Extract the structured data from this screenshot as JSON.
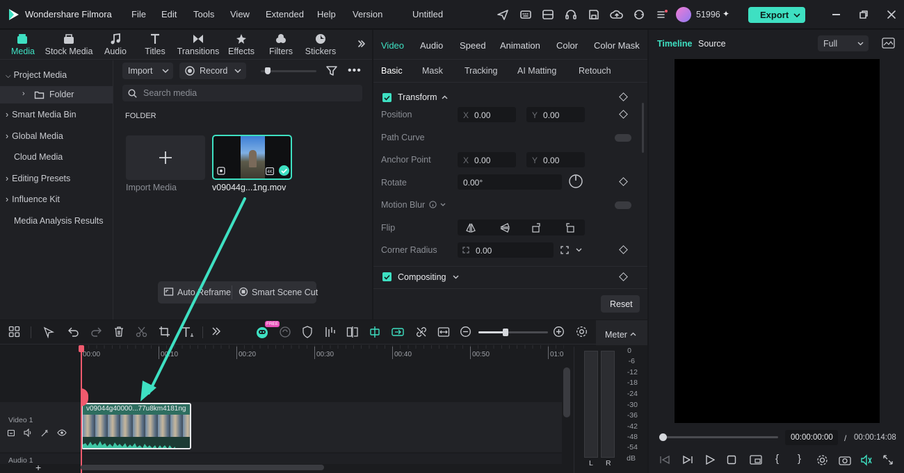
{
  "app": {
    "name": "Wondershare Filmora",
    "project": "Untitled",
    "credits": "51996",
    "export_label": "Export"
  },
  "menu": [
    "File",
    "Edit",
    "Tools",
    "View",
    "Extended",
    "Help",
    "Version"
  ],
  "toolbar": [
    {
      "label": "Media",
      "icon": "media-icon",
      "active": true
    },
    {
      "label": "Stock Media",
      "icon": "stock-media-icon"
    },
    {
      "label": "Audio",
      "icon": "audio-icon"
    },
    {
      "label": "Titles",
      "icon": "titles-icon"
    },
    {
      "label": "Transitions",
      "icon": "transitions-icon"
    },
    {
      "label": "Effects",
      "icon": "effects-icon"
    },
    {
      "label": "Filters",
      "icon": "filters-icon"
    },
    {
      "label": "Stickers",
      "icon": "stickers-icon"
    }
  ],
  "sidebar": {
    "items": [
      {
        "label": "Project Media",
        "expanded": true
      },
      {
        "label": "Folder",
        "selected": true
      },
      {
        "label": "Smart Media Bin"
      },
      {
        "label": "Global Media"
      },
      {
        "label": "Cloud Media"
      },
      {
        "label": "Editing Presets"
      },
      {
        "label": "Influence Kit"
      },
      {
        "label": "Media Analysis Results"
      }
    ]
  },
  "media": {
    "import_label": "Import",
    "record_label": "Record",
    "search_placeholder": "Search media",
    "folder_heading": "FOLDER",
    "import_media_label": "Import Media",
    "clip_name": "v09044g...1ng.mov",
    "auto_reframe": "Auto Reframe",
    "smart_scene_cut": "Smart Scene Cut"
  },
  "properties": {
    "tabs": [
      "Video",
      "Audio",
      "Speed",
      "Animation",
      "Color",
      "Color Mask"
    ],
    "subtabs": [
      "Basic",
      "Mask",
      "Tracking",
      "AI Matting",
      "Retouch"
    ],
    "transform": "Transform",
    "position": "Position",
    "x_label": "X",
    "y_label": "Y",
    "pos_x": "0.00",
    "pos_y": "0.00",
    "path_curve": "Path Curve",
    "anchor_point": "Anchor Point",
    "anchor_x": "0.00",
    "anchor_y": "0.00",
    "rotate": "Rotate",
    "rotate_value": "0.00°",
    "motion_blur": "Motion Blur",
    "flip": "Flip",
    "corner_radius": "Corner Radius",
    "corner_value": "0.00",
    "compositing": "Compositing",
    "reset": "Reset"
  },
  "preview": {
    "tabs": [
      "Timeline",
      "Source"
    ],
    "quality": "Full",
    "current_time": "00:00:00:00",
    "separator": "/",
    "total_time": "00:00:14:08"
  },
  "timeline": {
    "meter_label": "Meter",
    "ruler": [
      "00:00",
      "00:10",
      "00:20",
      "00:30",
      "00:40",
      "00:50",
      "01:0"
    ],
    "video_track": "Video 1",
    "audio_track": "Audio 1",
    "clip_title": "v09044g40000...77u8km4181ng",
    "meter_db": [
      "0",
      "-6",
      "-12",
      "-18",
      "-24",
      "-30",
      "-36",
      "-42",
      "-48",
      "-54",
      "dB"
    ],
    "meter_lr": [
      "L",
      "R"
    ],
    "ai_badge": "FREE"
  },
  "colors": {
    "accent": "#3ee0c2",
    "export_bg": "#3ee0c2",
    "playhead": "#f05a6e",
    "bg": "#18191c",
    "panel": "#1f2024"
  }
}
